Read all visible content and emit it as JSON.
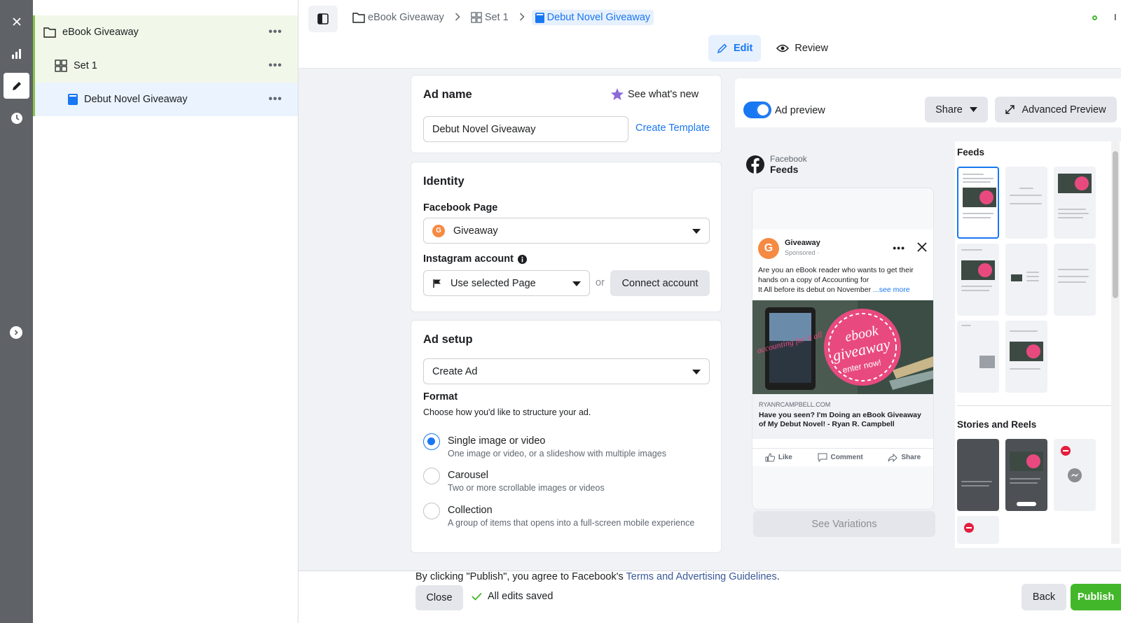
{
  "rail": {
    "items": [
      "close",
      "reporting",
      "edit",
      "history"
    ]
  },
  "tree": {
    "campaign": "eBook Giveaway",
    "adset": "Set 1",
    "ad": "Debut Novel Giveaway",
    "more": "•••"
  },
  "topbar": {
    "crumb_campaign": "eBook Giveaway",
    "crumb_set": "Set 1",
    "crumb_ad": "Debut Novel Giveaway",
    "status": "I",
    "tab_edit": "Edit",
    "tab_review": "Review"
  },
  "ad_name": {
    "title": "Ad name",
    "whats_new": "See what's new",
    "value": "Debut Novel Giveaway",
    "create_template": "Create Template"
  },
  "identity": {
    "title": "Identity",
    "fb_page_label": "Facebook Page",
    "fb_page_value": "Giveaway",
    "fb_page_avatar": "G",
    "ig_label": "Instagram account",
    "ig_value": "Use selected Page",
    "or": "or",
    "connect": "Connect account"
  },
  "ad_setup": {
    "title": "Ad setup",
    "value": "Create Ad",
    "format_label": "Format",
    "format_desc": "Choose how you'd like to structure your ad.",
    "options": [
      {
        "title": "Single image or video",
        "desc": "One image or video, or a slideshow with multiple images",
        "selected": true
      },
      {
        "title": "Carousel",
        "desc": "Two or more scrollable images or videos",
        "selected": false
      },
      {
        "title": "Collection",
        "desc": "A group of items that opens into a full-screen mobile experience",
        "selected": false
      }
    ]
  },
  "preview": {
    "toggle_label": "Ad preview",
    "share": "Share",
    "advanced": "Advanced Preview",
    "platform": "Facebook",
    "placement": "Feeds",
    "post": {
      "page": "Giveaway",
      "sponsored": "Sponsored · ",
      "text_1": "Are you an eBook reader who wants to get their",
      "text_2": "hands on a copy of Accounting for",
      "text_3": "It All before its debut on November",
      "see_more": "...see more",
      "img_stamp_1": "ebook",
      "img_stamp_2": "giveaway",
      "img_stamp_3": "enter now!",
      "img_book": "accounting for it all",
      "domain": "RYANRCAMPBELL.COM",
      "headline_1": "Have you seen? I'm Doing an eBook Giveaway",
      "headline_2": "of My Debut Novel! - Ryan R. Campbell",
      "like": "Like",
      "comment": "Comment",
      "share": "Share"
    },
    "see_variations": "See Variations",
    "feeds_title": "Feeds",
    "stories_title": "Stories and Reels"
  },
  "bottom": {
    "disclaimer_prefix": "By clicking \"Publish\", you agree to Facebook's ",
    "disclaimer_link": "Terms and Advertising Guidelines",
    "disclaimer_suffix": ".",
    "close": "Close",
    "saved": "All edits saved",
    "back": "Back",
    "publish": "Publish"
  },
  "colors": {
    "brand": "#1877f2",
    "publish": "#42b72a",
    "rail": "#5f6368"
  }
}
